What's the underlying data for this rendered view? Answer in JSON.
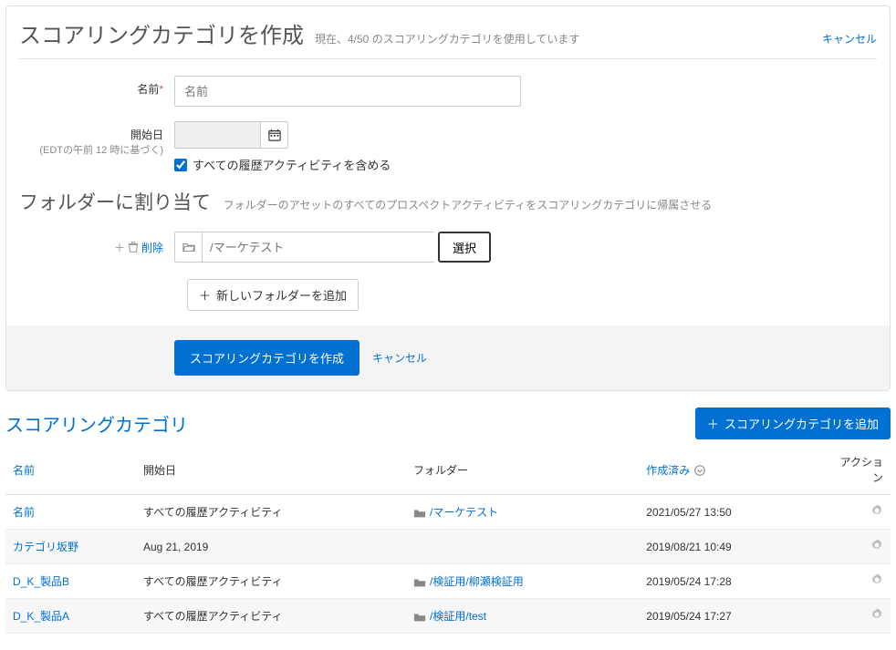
{
  "header": {
    "title": "スコアリングカテゴリを作成",
    "subtitle": "現在、4/50 のスコアリングカテゴリを使用しています",
    "cancel": "キャンセル"
  },
  "form": {
    "name_label": "名前",
    "name_placeholder": "名前",
    "start_label": "開始日",
    "start_sublabel": "(EDTの午前 12 時に基づく)",
    "include_history_label": "すべての履歴アクティビティを含める"
  },
  "folder_section": {
    "title": "フォルダーに割り当て",
    "desc": "フォルダーのアセットのすべてのプロスペクトアクティビティをスコアリングカテゴリに帰属させる",
    "delete": "削除",
    "path_placeholder": "/マーケテスト",
    "select": "選択",
    "add_new": "新しいフォルダーを追加"
  },
  "actions": {
    "create": "スコアリングカテゴリを作成",
    "cancel": "キャンセル"
  },
  "list": {
    "title": "スコアリングカテゴリ",
    "add_button": "スコアリングカテゴリを追加",
    "cols": {
      "name": "名前",
      "start": "開始日",
      "folder": "フォルダー",
      "created": "作成済み",
      "actions": "アクション"
    },
    "rows": [
      {
        "name": "名前",
        "start": "すべての履歴アクティビティ",
        "folder": "/マーケテスト",
        "has_folder": true,
        "created": "2021/05/27 13:50"
      },
      {
        "name": "カテゴリ坂野",
        "start": "Aug 21, 2019",
        "folder": "",
        "has_folder": false,
        "created": "2019/08/21 10:49"
      },
      {
        "name": "D_K_製品B",
        "start": "すべての履歴アクティビティ",
        "folder": "/検証用/柳瀬検証用",
        "has_folder": true,
        "created": "2019/05/24 17:28"
      },
      {
        "name": "D_K_製品A",
        "start": "すべての履歴アクティビティ",
        "folder": "/検証用/test",
        "has_folder": true,
        "created": "2019/05/24 17:27"
      }
    ]
  }
}
